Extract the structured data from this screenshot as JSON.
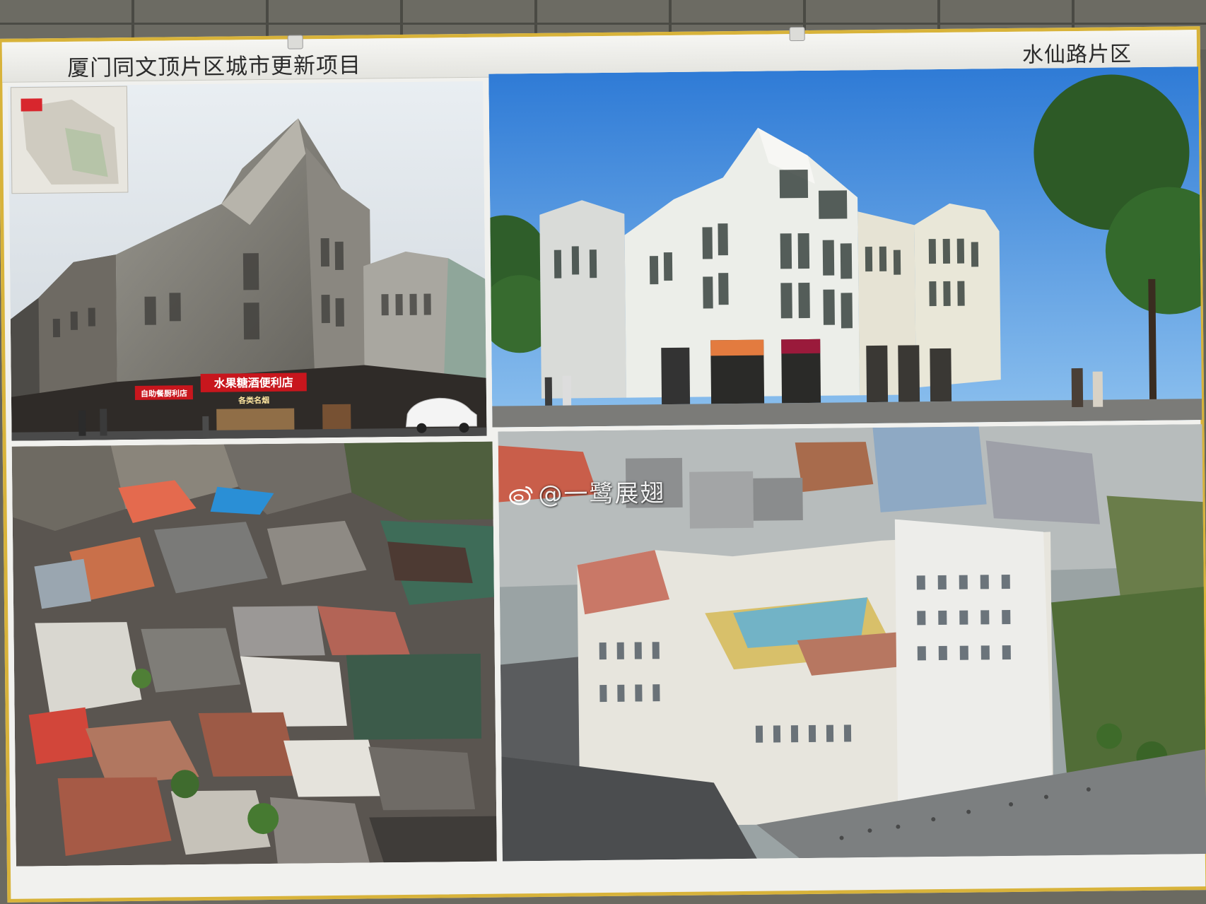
{
  "poster": {
    "title": "厦门同文顶片区城市更新项目",
    "district": "水仙路片区"
  },
  "watermark": {
    "text": "@一鹭展翅"
  },
  "signs": {
    "shop_main": "水果糖酒便利店",
    "shop_main_sub": "各类名烟",
    "shop_left": "自助餐厨利店"
  },
  "colors": {
    "board_frame": "#d8b33a",
    "board_bg": "#f1f1ee",
    "sign_red": "#c8161d"
  }
}
